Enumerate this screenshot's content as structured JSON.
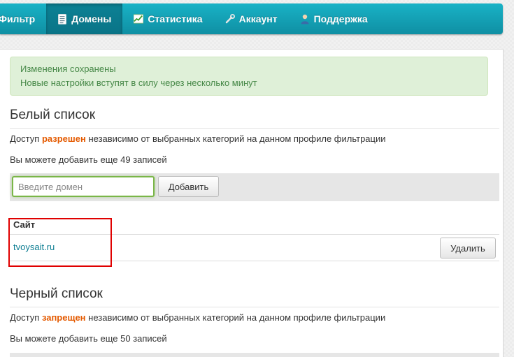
{
  "nav": {
    "items": [
      {
        "label": "Фильтр",
        "icon": "none",
        "active": false
      },
      {
        "label": "Домены",
        "icon": "document-icon",
        "active": true
      },
      {
        "label": "Статистика",
        "icon": "chart-icon",
        "active": false
      },
      {
        "label": "Аккаунт",
        "icon": "wrench-icon",
        "active": false
      },
      {
        "label": "Поддержка",
        "icon": "user-icon",
        "active": false
      }
    ]
  },
  "alert": {
    "line1": "Изменения сохранены",
    "line2": "Новые настройки вступят в силу через несколько минут"
  },
  "whitelist": {
    "title": "Белый список",
    "desc_before": "Доступ ",
    "desc_highlight": "разрешен",
    "desc_after": " независимо от выбранных категорий на данном профиле фильтрации",
    "remaining": "Вы можете добавить еще 49 записей",
    "input_placeholder": "Введите домен",
    "add_button": "Добавить",
    "column_header": "Сайт",
    "rows": [
      {
        "site": "tvoysait.ru",
        "delete_label": "Удалить"
      }
    ]
  },
  "blacklist": {
    "title": "Черный список",
    "desc_before": "Доступ ",
    "desc_highlight": "запрещен",
    "desc_after": " независимо от выбранных категорий на данном профиле фильтрации",
    "remaining": "Вы можете добавить еще 50 записей"
  },
  "colors": {
    "nav_bg": "#14a3b8",
    "alert_bg": "#dff0d8",
    "alert_text": "#468847",
    "highlight": "#e45a00",
    "link": "#0e7e93",
    "annotation_box": "#e00000"
  }
}
